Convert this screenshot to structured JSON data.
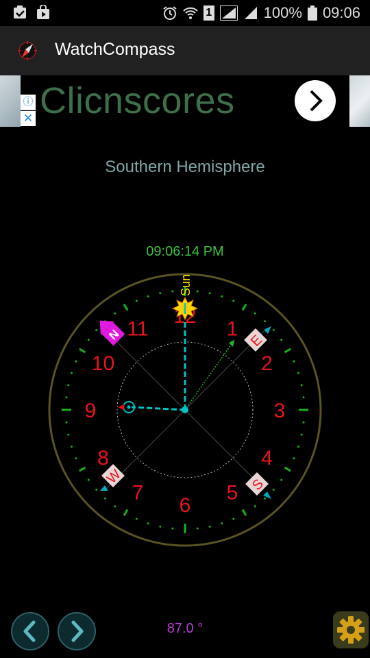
{
  "status_bar": {
    "sim_slot": "1",
    "battery": "100%",
    "time": "09:06"
  },
  "app_bar": {
    "title": "WatchCompass"
  },
  "ad": {
    "text": "Clicnscores",
    "info_icon": "info-icon",
    "close_label": "✕"
  },
  "hemisphere_label": "Southern Hemisphere",
  "clock_time": "09:06:14 PM",
  "compass": {
    "numbers": [
      "12",
      "1",
      "2",
      "3",
      "4",
      "5",
      "6",
      "7",
      "8",
      "9",
      "10",
      "11"
    ],
    "sun_label": "Sun",
    "directions": {
      "north": "N",
      "east": "E",
      "south": "S",
      "west": "W"
    },
    "colors": {
      "numbers": "#e8141b",
      "ticks": "#19b319",
      "ring": "#5a5422",
      "sun": "#ffe000",
      "hand": "#00c2c2",
      "north": "#e01ae0"
    }
  },
  "footer": {
    "heading": "87.0 °",
    "prev_icon": "chevron-left-icon",
    "next_icon": "chevron-right-icon",
    "settings_icon": "gear-icon"
  }
}
